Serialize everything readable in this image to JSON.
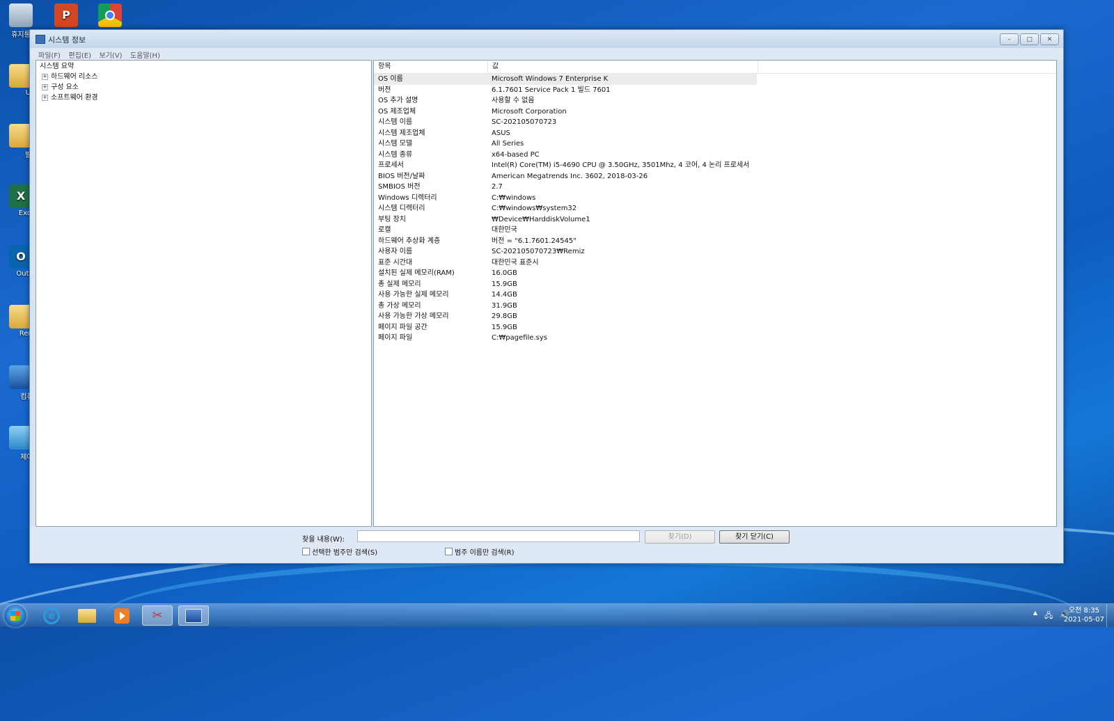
{
  "desktop": {
    "icons": [
      {
        "label": "휴지통",
        "icon": "recycle-bin-icon"
      },
      {
        "label": "",
        "icon": "powerpoint-icon"
      },
      {
        "label": "",
        "icon": "chrome-icon"
      },
      {
        "label": "Util",
        "icon": "folder-icon"
      },
      {
        "label": "필독",
        "icon": "folder-icon"
      },
      {
        "label": "Excel",
        "icon": "excel-icon"
      },
      {
        "label": "Outloo",
        "icon": "outlook-icon"
      },
      {
        "label": "Remiz",
        "icon": "folder-icon"
      },
      {
        "label": "컴퓨터",
        "icon": "computer-icon"
      },
      {
        "label": "제어판",
        "icon": "control-panel-icon"
      }
    ]
  },
  "window": {
    "title": "시스템 정보",
    "controls": {
      "minimize": "–",
      "maximize": "□",
      "close": "✕"
    },
    "menu": [
      "파일(F)",
      "편집(E)",
      "보기(V)",
      "도움말(H)"
    ]
  },
  "tree": {
    "root": "시스템 요약",
    "children": [
      "하드웨어 리소스",
      "구성 요소",
      "소프트웨어 환경"
    ],
    "expander": "+"
  },
  "table": {
    "headers": [
      "항목",
      "값"
    ],
    "rows": [
      [
        "OS 이름",
        "Microsoft Windows 7 Enterprise K"
      ],
      [
        "버전",
        "6.1.7601 Service Pack 1 빌드 7601"
      ],
      [
        "OS 추가 설명",
        "사용할 수 없음"
      ],
      [
        "OS 제조업체",
        "Microsoft Corporation"
      ],
      [
        "시스템 이름",
        "SC-202105070723"
      ],
      [
        "시스템 제조업체",
        "ASUS"
      ],
      [
        "시스템 모델",
        "All Series"
      ],
      [
        "시스템 종류",
        "x64-based PC"
      ],
      [
        "프로세서",
        "Intel(R) Core(TM) i5-4690 CPU @ 3.50GHz, 3501Mhz, 4 코어, 4 논리 프로세서"
      ],
      [
        "BIOS 버전/날짜",
        "American Megatrends Inc. 3602, 2018-03-26"
      ],
      [
        "SMBIOS 버전",
        "2.7"
      ],
      [
        "Windows 디렉터리",
        "C:₩windows"
      ],
      [
        "시스템 디렉터리",
        "C:₩windows₩system32"
      ],
      [
        "부팅 장치",
        "₩Device₩HarddiskVolume1"
      ],
      [
        "로캘",
        "대한민국"
      ],
      [
        "하드웨어 추상화 계층",
        "버전 = \"6.1.7601.24545\""
      ],
      [
        "사용자 이름",
        "SC-202105070723₩Remiz"
      ],
      [
        "표준 시간대",
        "대한민국 표준시"
      ],
      [
        "설치된 실제 메모리(RAM)",
        "16.0GB"
      ],
      [
        "총 실제 메모리",
        "15.9GB"
      ],
      [
        "사용 가능한 실제 메모리",
        "14.4GB"
      ],
      [
        "총 가상 메모리",
        "31.9GB"
      ],
      [
        "사용 가능한 가상 메모리",
        "29.8GB"
      ],
      [
        "페이지 파일 공간",
        "15.9GB"
      ],
      [
        "페이지 파일",
        "C:₩pagefile.sys"
      ]
    ]
  },
  "find": {
    "label": "찾을 내용(W):",
    "value": "",
    "find_button": "찾기(D)",
    "close_button": "찾기 닫기(C)",
    "checkbox_selected_category": "선택한 범주만 검색(S)",
    "checkbox_category_names": "범주 이름만 검색(R)"
  },
  "taskbar": {
    "items": [
      "start-button",
      "internet-explorer",
      "file-explorer",
      "media-player",
      "snipping-tool",
      "system-information"
    ],
    "tray_arrow": "▲",
    "time": "오전 8:35",
    "date": "2021-05-07"
  }
}
